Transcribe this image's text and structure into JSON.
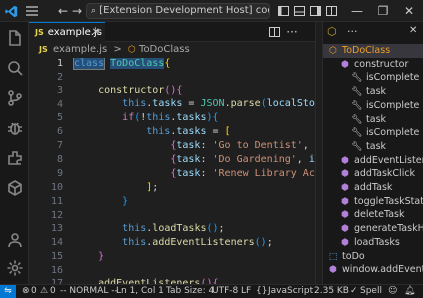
{
  "titlebar": {
    "menu_icon": "hamburger-menu-icon",
    "search_text": "[Extension Development Host] code-..."
  },
  "tab": {
    "lang": "JS",
    "filename": "example.js"
  },
  "breadcrumb": {
    "file": "example.js",
    "separator": ">",
    "symbol": "ToDoClass"
  },
  "editor": {
    "line_numbers": [
      "1",
      "2",
      "3",
      "4",
      "5",
      "6",
      "7",
      "8",
      "9",
      "10",
      "11",
      "12",
      "13",
      "14",
      "15",
      "16",
      "17"
    ],
    "current_line": "1"
  },
  "outline": {
    "items": [
      {
        "label": "ToDoClass",
        "icon": "class-icon",
        "indent": 0
      },
      {
        "label": "constructor",
        "icon": "method-icon",
        "indent": 1
      },
      {
        "label": "isComplete",
        "icon": "property-icon",
        "indent": 2
      },
      {
        "label": "task",
        "icon": "property-icon",
        "indent": 2
      },
      {
        "label": "isComplete",
        "icon": "property-icon",
        "indent": 2
      },
      {
        "label": "task",
        "icon": "property-icon",
        "indent": 2
      },
      {
        "label": "isComplete",
        "icon": "property-icon",
        "indent": 2
      },
      {
        "label": "task",
        "icon": "property-icon",
        "indent": 2
      },
      {
        "label": "addEventListener",
        "icon": "method-icon",
        "indent": 1
      },
      {
        "label": "addTaskClick",
        "icon": "method-icon",
        "indent": 1
      },
      {
        "label": "addTask",
        "icon": "method-icon",
        "indent": 1
      },
      {
        "label": "toggleTaskStatus",
        "icon": "method-icon",
        "indent": 1
      },
      {
        "label": "deleteTask",
        "icon": "method-icon",
        "indent": 1
      },
      {
        "label": "generateTaskHtm",
        "icon": "method-icon",
        "indent": 1
      },
      {
        "label": "loadTasks",
        "icon": "method-icon",
        "indent": 1
      },
      {
        "label": "toDo",
        "icon": "variable-icon",
        "indent": 0
      },
      {
        "label": "window.addEventList",
        "icon": "method-icon",
        "indent": 0
      }
    ]
  },
  "status": {
    "errors": "0",
    "warnings": "0",
    "mode": "-- NORMAL --",
    "position": "Ln 1, Col 1",
    "tab_size": "Tab Size: 4",
    "encoding": "UTF-8",
    "eol": "LF",
    "language": "JavaScript",
    "file_size": "2.35 KB",
    "spell": "Spell"
  }
}
